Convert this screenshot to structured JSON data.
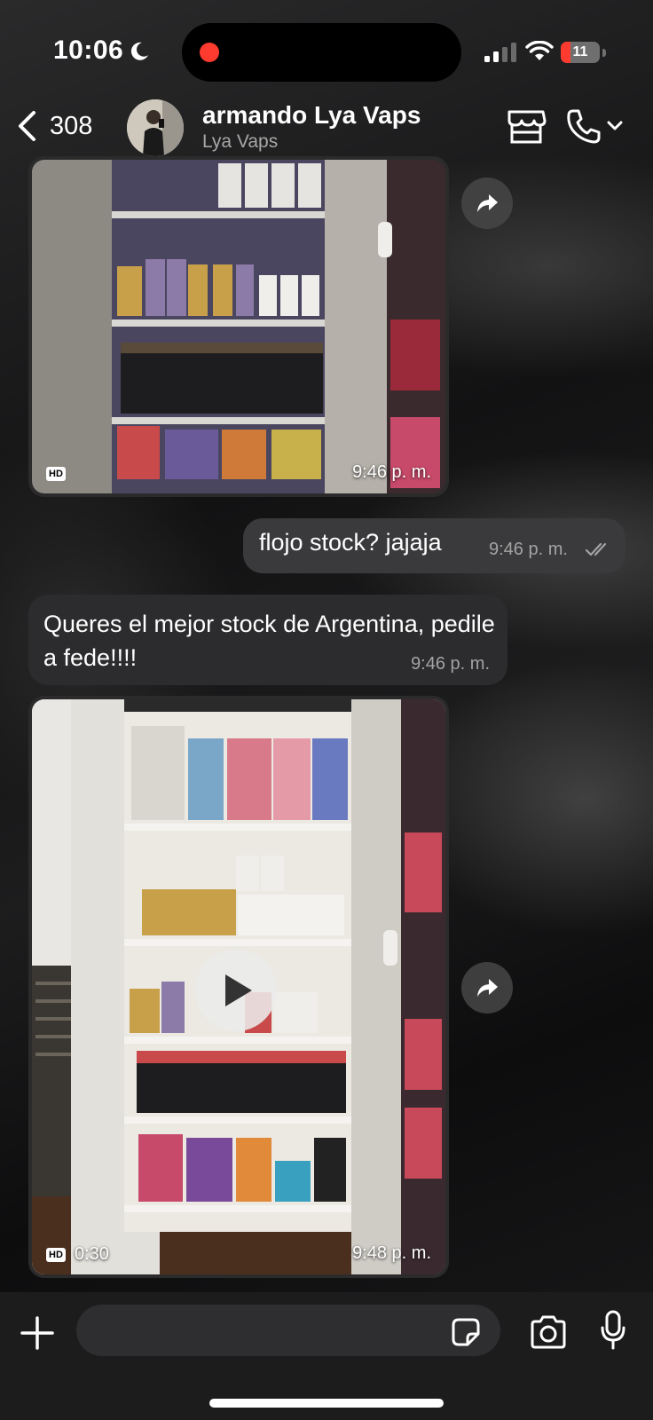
{
  "status_bar": {
    "time": "10:06",
    "battery_label": "11",
    "battery_level": 0.11,
    "recording_color": "#ff3b30",
    "icons": [
      "moon-icon",
      "signal-icon",
      "wifi-icon",
      "battery-icon"
    ]
  },
  "header": {
    "back_count": "308",
    "contact_name": "armando Lya Vaps",
    "contact_subtitle": "Lya Vaps",
    "icons": [
      "back-chevron-icon",
      "store-icon",
      "phone-icon",
      "chevron-down-icon"
    ]
  },
  "messages": [
    {
      "type": "image",
      "direction": "incoming",
      "badge": "HD",
      "time": "9:46 p. m."
    },
    {
      "type": "text",
      "direction": "outgoing",
      "text": "flojo stock? jajaja",
      "time": "9:46 p. m.",
      "status": "read"
    },
    {
      "type": "text",
      "direction": "incoming",
      "text": "Queres el mejor stock de Argentina, pedile a fede!!!!",
      "time": "9:46 p. m."
    },
    {
      "type": "video",
      "direction": "incoming",
      "badge": "HD",
      "duration": "0:30",
      "time": "9:48 p. m."
    }
  ],
  "composer": {
    "placeholder": "",
    "icons": [
      "plus-icon",
      "sticker-icon",
      "camera-icon",
      "microphone-icon"
    ]
  },
  "colors": {
    "outgoing_bubble": "#3a3a3c",
    "incoming_bubble": "#2c2c2e",
    "composer_bg": "#1c1c1d"
  }
}
